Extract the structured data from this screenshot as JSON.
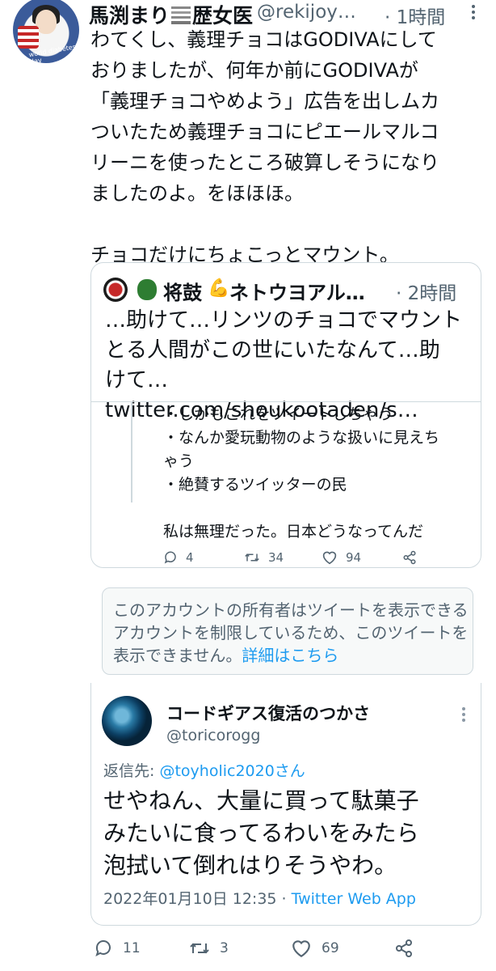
{
  "main_tweet": {
    "author_name": "馬渕まり",
    "author_name_suffix": "歴女医",
    "author_handle": "@rekijoy…",
    "time": "· 1時間",
    "body": "わてくし、義理チョコはGODIVAにして\nおりましたが、何年か前にGODIVAが\n「義理チョコやめよう」広告を出しムカ\nついたため義理チョコにピエールマルコ\nリーニを使ったところ破算しそうになり\nましたのよ。をほほほ。\n\nチョコだけにちょこっとマウント。",
    "avatar_text": "world diabetes day"
  },
  "quoted_tweet": {
    "author_name": "将鼓",
    "author_name_2": "ネトウヨアル…",
    "time": "· 2時間",
    "text": "…助けて…リンツのチョコでマウント\nとる人間がこの世にいたなんて…助\nけて… twitter.com/shoukootaden/s…",
    "inner_text": "・しかもこれをツイートしちゃう\n・なんか愛玩動物のような扱いに見えち\nゃう\n・絶賛するツイッターの民\n\n私は無理だった。日本どうなってんだ",
    "actions": {
      "reply_count": "4",
      "retweet_count": "34",
      "like_count": "94"
    }
  },
  "notice": {
    "text": "このアカウントの所有者はツイートを表示できるアカウントを制限しているため、このツイートを表示できません。",
    "link": "詳細はこちら"
  },
  "reply_tweet": {
    "author_name": "コードギアス復活のつかさ",
    "author_handle": "@toricorogg",
    "reply_to_label": "返信先: ",
    "reply_to_mention": "@toyholic2020さん",
    "text": "せやねん、大量に買って駄菓子\nみたいに食ってるわいをみたら\n泡拭いて倒れはりそうやわ。",
    "timestamp": "2022年01月10日 12:35 · ",
    "client": "Twitter Web App"
  },
  "bottom_actions": {
    "reply_count": "11",
    "retweet_count": "3",
    "like_count": "69"
  },
  "colors": {
    "link": "#1d9bf0",
    "muted": "#536471",
    "border": "#cfd9de",
    "text": "#0f1419"
  },
  "icons": [
    "reply-icon",
    "retweet-icon",
    "like-icon",
    "share-icon",
    "more-icon"
  ]
}
